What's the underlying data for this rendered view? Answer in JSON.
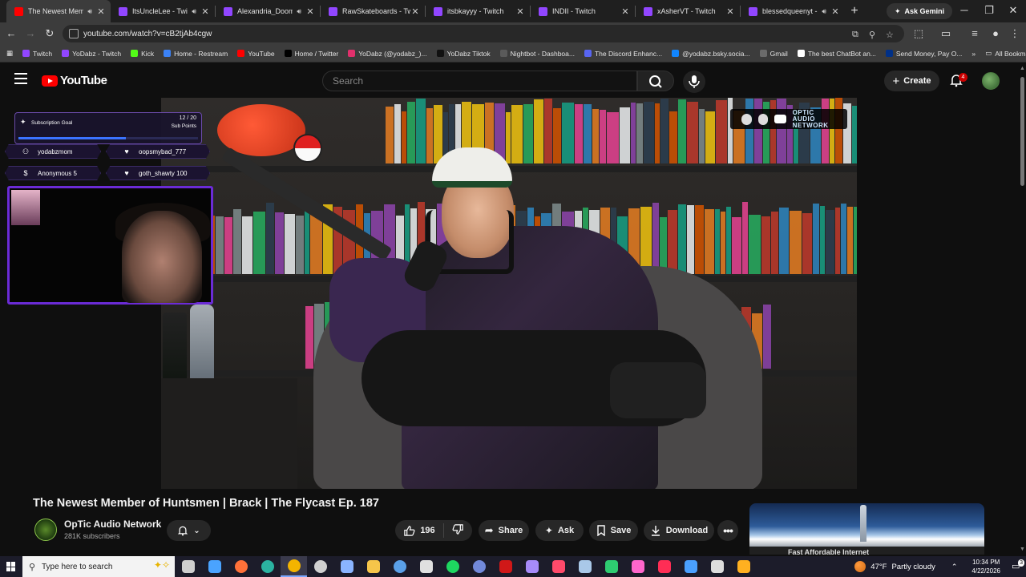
{
  "browser": {
    "tabs": [
      {
        "title": "The Newest Memb",
        "favicon": "#ff0000",
        "audio": true,
        "active": true
      },
      {
        "title": "ItsUncleLee - Twitch",
        "favicon": "#9146ff",
        "audio": true,
        "active": false
      },
      {
        "title": "Alexandria_Doom",
        "favicon": "#9146ff",
        "audio": true,
        "active": false
      },
      {
        "title": "RawSkateboards - Twit",
        "favicon": "#9146ff",
        "audio": false,
        "active": false
      },
      {
        "title": "itsbkayyy - Twitch",
        "favicon": "#9146ff",
        "audio": false,
        "active": false
      },
      {
        "title": "INDII - Twitch",
        "favicon": "#9146ff",
        "audio": false,
        "active": false
      },
      {
        "title": "xAsherVT - Twitch",
        "favicon": "#9146ff",
        "audio": false,
        "active": false
      },
      {
        "title": "blessedqueenyt - T",
        "favicon": "#9146ff",
        "audio": true,
        "active": false
      }
    ],
    "new_tab": "+",
    "ask_gemini": "Ask Gemini",
    "url": "youtube.com/watch?v=cB2tjAb4cgw",
    "bookmarks": [
      {
        "label": "Twitch",
        "color": "#9146ff"
      },
      {
        "label": "YoDabz - Twitch",
        "color": "#9146ff"
      },
      {
        "label": "Kick",
        "color": "#53fc18"
      },
      {
        "label": "Home - Restream",
        "color": "#3b82f6"
      },
      {
        "label": "YouTube",
        "color": "#ff0000"
      },
      {
        "label": "Home / Twitter",
        "color": "#000000"
      },
      {
        "label": "YoDabz (@yodabz_)...",
        "color": "#e1306c"
      },
      {
        "label": "YoDabz Tiktok",
        "color": "#111111"
      },
      {
        "label": "Nightbot - Dashboa...",
        "color": "#5a5a5a"
      },
      {
        "label": "The Discord Enhanc...",
        "color": "#5865f2"
      },
      {
        "label": "@yodabz.bsky.socia...",
        "color": "#1185fe"
      },
      {
        "label": "Gmail",
        "color": "#6b6b6b"
      },
      {
        "label": "The best ChatBot an...",
        "color": "#ffffff"
      },
      {
        "label": "Send Money, Pay O...",
        "color": "#003087"
      }
    ],
    "bookmarks_more": "»",
    "all_bookmarks": "All Bookmarks"
  },
  "youtube": {
    "logo_text": "YouTube",
    "search_placeholder": "Search",
    "create_label": "Create",
    "notification_count": "4",
    "video": {
      "title": "The Newest Member of Huntsmen | Brack | The Flycast Ep. 187",
      "channel": "OpTic Audio Network",
      "subscribers": "281K subscribers",
      "likes": "196",
      "share_label": "Share",
      "ask_label": "Ask",
      "save_label": "Save",
      "download_label": "Download",
      "watermark_line1": "OPTIC",
      "watermark_line2": "AUDIO NETWORK"
    },
    "side_card_title": "Fast Affordable Internet"
  },
  "stream_overlay": {
    "subscription_goal_label": "Subscription Goal",
    "goal_count": "12 / 20",
    "goal_unit": "Sub Points",
    "goal_progress": 0.6,
    "events": [
      {
        "icon": "follow-icon",
        "text": "yodabzmom"
      },
      {
        "icon": "heart-icon",
        "text": "oopsmybad_777"
      },
      {
        "icon": "dollar-icon",
        "text": "Anonymous 5"
      },
      {
        "icon": "heart-icon",
        "text": "goth_shawty 100"
      }
    ]
  },
  "taskbar": {
    "search_placeholder": "Type here to search",
    "weather_temp": "47°F",
    "weather_desc": "Partly cloudy",
    "time": "10:34 PM",
    "date": "4/22/2026",
    "notification_count": "3",
    "apps": [
      {
        "name": "task-view-icon",
        "color": "#cfcfcf"
      },
      {
        "name": "copilot-icon",
        "color": "#4aa3ff"
      },
      {
        "name": "firefox-icon",
        "color": "#ff7139"
      },
      {
        "name": "edge-icon",
        "color": "#2bb3a1"
      },
      {
        "name": "chrome-icon",
        "color": "#f4b400"
      },
      {
        "name": "obs-icon",
        "color": "#d0d0d0"
      },
      {
        "name": "app-icon",
        "color": "#8ab4ff"
      },
      {
        "name": "file-explorer-icon",
        "color": "#f6c54a"
      },
      {
        "name": "steam-icon",
        "color": "#5aa0e8"
      },
      {
        "name": "epic-games-icon",
        "color": "#e0e0e0"
      },
      {
        "name": "spotify-icon",
        "color": "#1ed760"
      },
      {
        "name": "discord-icon",
        "color": "#7289da"
      },
      {
        "name": "app-icon",
        "color": "#d01818"
      },
      {
        "name": "feather-icon",
        "color": "#a78bfa"
      },
      {
        "name": "app-icon",
        "color": "#ff4a6a"
      },
      {
        "name": "app-icon",
        "color": "#a9c8e8"
      },
      {
        "name": "app-icon",
        "color": "#2ecc71"
      },
      {
        "name": "app-icon",
        "color": "#ff66cc"
      },
      {
        "name": "tiktok-icon",
        "color": "#ff2d55"
      },
      {
        "name": "app-icon",
        "color": "#4aa0ff"
      },
      {
        "name": "settings-icon",
        "color": "#dddddd"
      },
      {
        "name": "app-icon",
        "color": "#ffb020"
      }
    ]
  }
}
